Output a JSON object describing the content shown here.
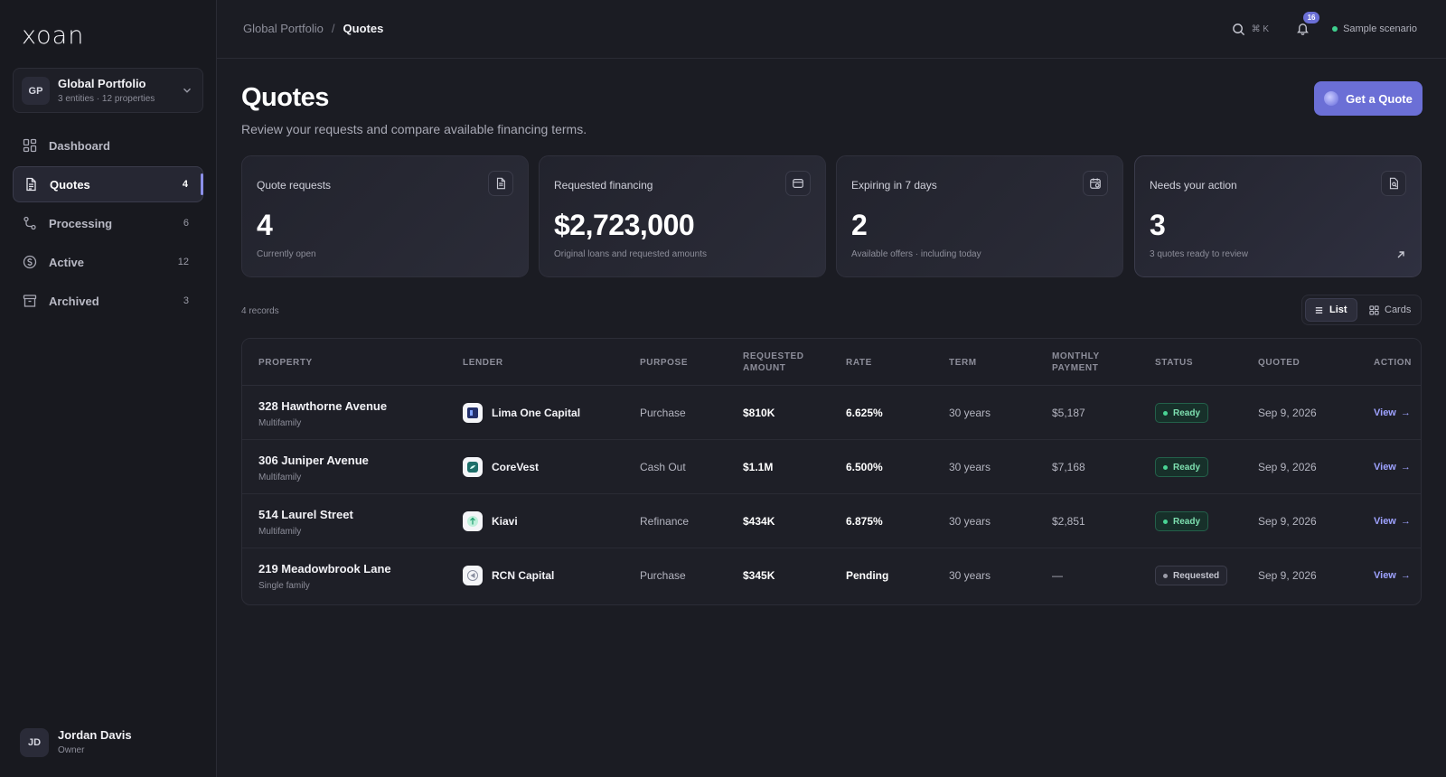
{
  "brand": {
    "logo_text": "xoan",
    "accent": "#6b6fd6"
  },
  "portfolio": {
    "initials": "GP",
    "name": "Global Portfolio",
    "meta": "3 entities · 12 properties"
  },
  "nav": {
    "items": [
      {
        "label": "Dashboard",
        "count": "",
        "icon": "dashboard-icon"
      },
      {
        "label": "Quotes",
        "count": "4",
        "icon": "document-icon",
        "active": true
      },
      {
        "label": "Processing",
        "count": "6",
        "icon": "route-icon"
      },
      {
        "label": "Active",
        "count": "12",
        "icon": "dollar-icon"
      },
      {
        "label": "Archived",
        "count": "3",
        "icon": "archive-icon"
      }
    ]
  },
  "user": {
    "initials": "JD",
    "name": "Jordan Davis",
    "role": "Owner"
  },
  "topbar": {
    "breadcrumb": {
      "parent": "Global Portfolio",
      "separator": "/",
      "current": "Quotes"
    },
    "shortcut": "⌘ K",
    "notifications": "16",
    "scenario": "Sample scenario"
  },
  "header": {
    "title": "Quotes",
    "subtitle": "Review your requests and compare available financing terms.",
    "cta": "Get a Quote"
  },
  "stats": [
    {
      "label": "Quote requests",
      "value": "4",
      "sub": "Currently open",
      "icon": "document-icon"
    },
    {
      "label": "Requested financing",
      "value": "$2,723,000",
      "sub": "Original loans and requested amounts",
      "icon": "wallet-icon"
    },
    {
      "label": "Expiring in 7 days",
      "value": "2",
      "sub": "Available offers · including today",
      "icon": "calendar-clock-icon"
    },
    {
      "label": "Needs your action",
      "value": "3",
      "sub": "3 quotes ready to review",
      "icon": "file-search-icon"
    }
  ],
  "records": "4 records",
  "view_toggle": {
    "list": "List",
    "cards": "Cards",
    "selected": "List"
  },
  "table": {
    "columns": [
      "Property",
      "Lender",
      "Purpose",
      "Requested Amount",
      "Rate",
      "Term",
      "Monthly Payment",
      "Status",
      "Quoted",
      "Action"
    ],
    "rows": [
      {
        "property": "328 Hawthorne Avenue",
        "type": "Multifamily",
        "lender": "Lima One Capital",
        "purpose": "Purchase",
        "amount": "$810K",
        "rate": "6.625%",
        "term": "30 years",
        "payment": "$5,187",
        "status": "Ready",
        "quoted": "Sep 9, 2026",
        "action": "View"
      },
      {
        "property": "306 Juniper Avenue",
        "type": "Multifamily",
        "lender": "CoreVest",
        "purpose": "Cash Out",
        "amount": "$1.1M",
        "rate": "6.500%",
        "term": "30 years",
        "payment": "$7,168",
        "status": "Ready",
        "quoted": "Sep 9, 2026",
        "action": "View"
      },
      {
        "property": "514 Laurel Street",
        "type": "Multifamily",
        "lender": "Kiavi",
        "purpose": "Refinance",
        "amount": "$434K",
        "rate": "6.875%",
        "term": "30 years",
        "payment": "$2,851",
        "status": "Ready",
        "quoted": "Sep 9, 2026",
        "action": "View"
      },
      {
        "property": "219 Meadowbrook Lane",
        "type": "Single family",
        "lender": "RCN Capital",
        "purpose": "Purchase",
        "amount": "$345K",
        "rate": "Pending",
        "term": "30 years",
        "payment": "—",
        "status": "Requested",
        "quoted": "Sep 9, 2026",
        "action": "View"
      }
    ]
  }
}
